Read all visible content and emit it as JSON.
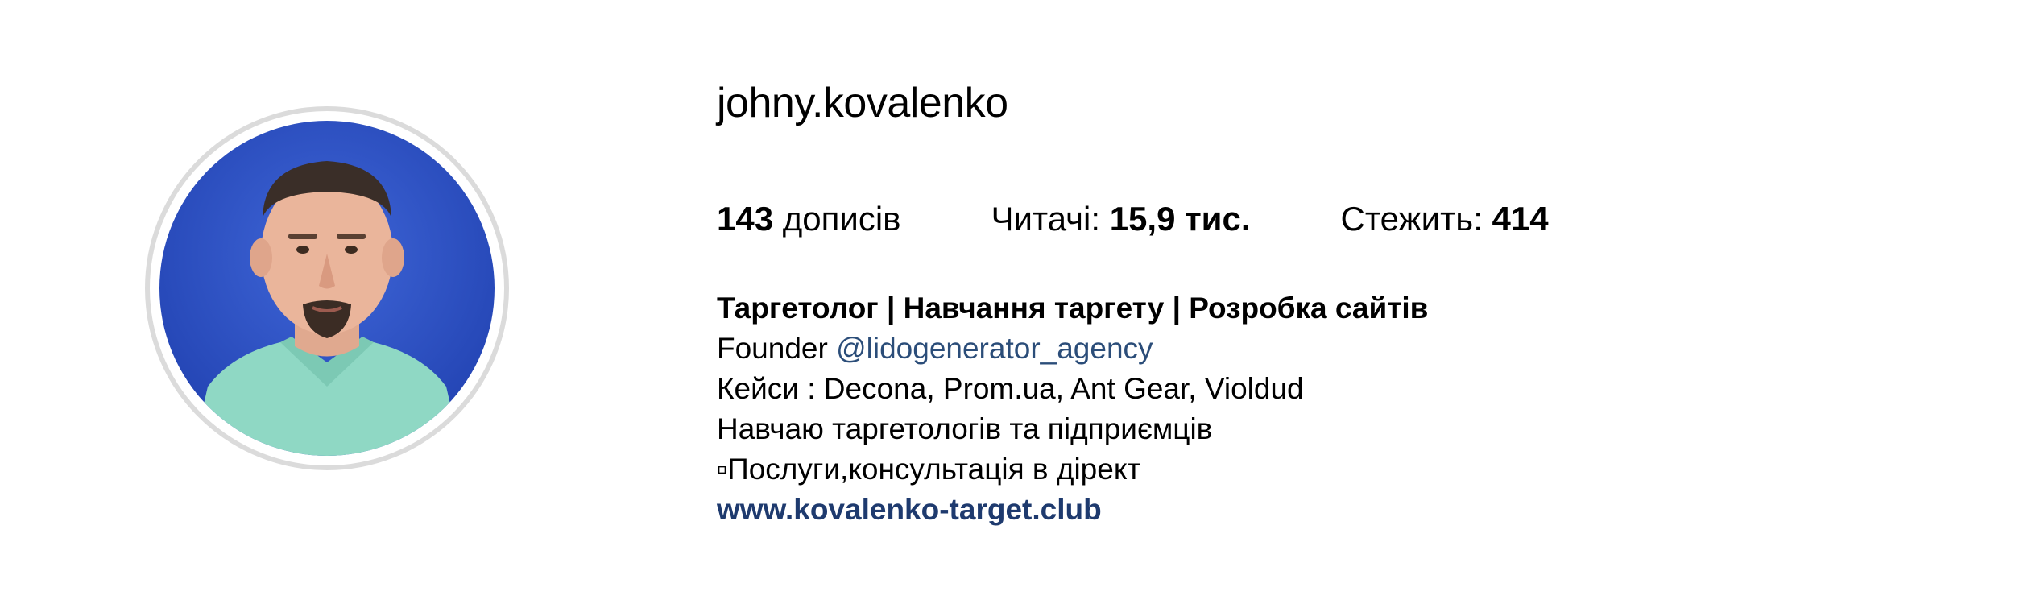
{
  "profile": {
    "username": "johny.kovalenko",
    "avatar_icon": "profile-photo"
  },
  "stats": {
    "posts_count": "143",
    "posts_label": "дописів",
    "followers_label": "Читачі: ",
    "followers_count": "15,9 тис.",
    "following_label": "Стежить: ",
    "following_count": "414"
  },
  "bio": {
    "title": "Таргетолог | Навчання таргету | Розробка сайтів",
    "founder_prefix": "Founder ",
    "founder_mention": "@lidogenerator_agency",
    "cases": "Кейси : Decona, Prom.ua, Ant Gear, Violdud",
    "teaching": "Навчаю таргетологів та підприємців",
    "services": "▫Послуги,консультація в дірект",
    "website": "www.kovalenko-target.club"
  },
  "colors": {
    "mention": "#2b4d79",
    "link": "#1e3a6e",
    "avatar_ring": "#dbdbdb",
    "avatar_background": "#2c4fc4",
    "shirt": "#8fd8c4"
  }
}
